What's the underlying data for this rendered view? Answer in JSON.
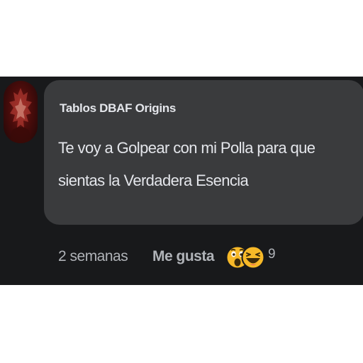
{
  "comment": {
    "author": "Tablos DBAF Origins",
    "text": "Te voy a Golpear con mi Polla para que sientas la Verdadera Esencia",
    "timestamp": "2 semanas",
    "like_label": "Me gusta",
    "reaction_count": "9",
    "reactions": [
      "wow-reaction-icon",
      "haha-reaction-icon"
    ]
  },
  "colors": {
    "background": "#18191b",
    "bubble": "#3a3b3d",
    "text": "#e4e6eb",
    "secondary_text": "#b0b3b8",
    "reaction_yellow": "#f7b928"
  }
}
